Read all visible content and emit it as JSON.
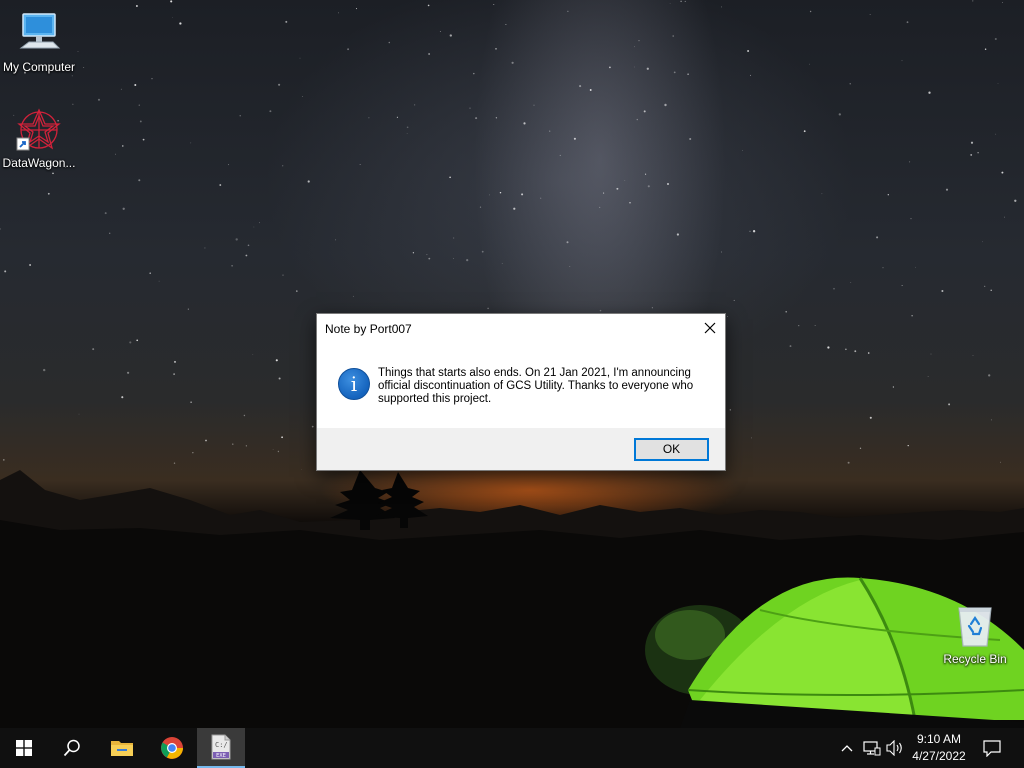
{
  "desktop": {
    "icons": [
      {
        "label": "My Computer",
        "icon": "monitor-icon"
      },
      {
        "label": "DataWagon...",
        "icon": "datawagon-shortcut-icon"
      },
      {
        "label": "Recycle Bin",
        "icon": "recycle-bin-icon"
      }
    ]
  },
  "dialog": {
    "title": "Note by Port007",
    "message": "Things that starts also ends. On 21 Jan 2021, I'm announcing official discontinuation of GCS Utility. Thanks to everyone who supported this project.",
    "icon": "info-icon",
    "ok_label": "OK",
    "accent": "#0078d7"
  },
  "taskbar": {
    "items": [
      {
        "name": "start",
        "icon": "windows-logo-icon"
      },
      {
        "name": "search",
        "icon": "search-icon"
      },
      {
        "name": "file-explorer",
        "icon": "folder-icon"
      },
      {
        "name": "chrome",
        "icon": "chrome-icon"
      },
      {
        "name": "exe-app",
        "icon": "exe-file-icon",
        "badge": "EXE",
        "active": true
      }
    ],
    "tray": {
      "chevron": "chevron-up-icon",
      "network": "network-icon",
      "volume": "speaker-icon",
      "notifications": "notification-icon"
    },
    "clock": {
      "time": "9:10 AM",
      "date": "4/27/2022"
    },
    "active_color": "#76b9ed"
  }
}
